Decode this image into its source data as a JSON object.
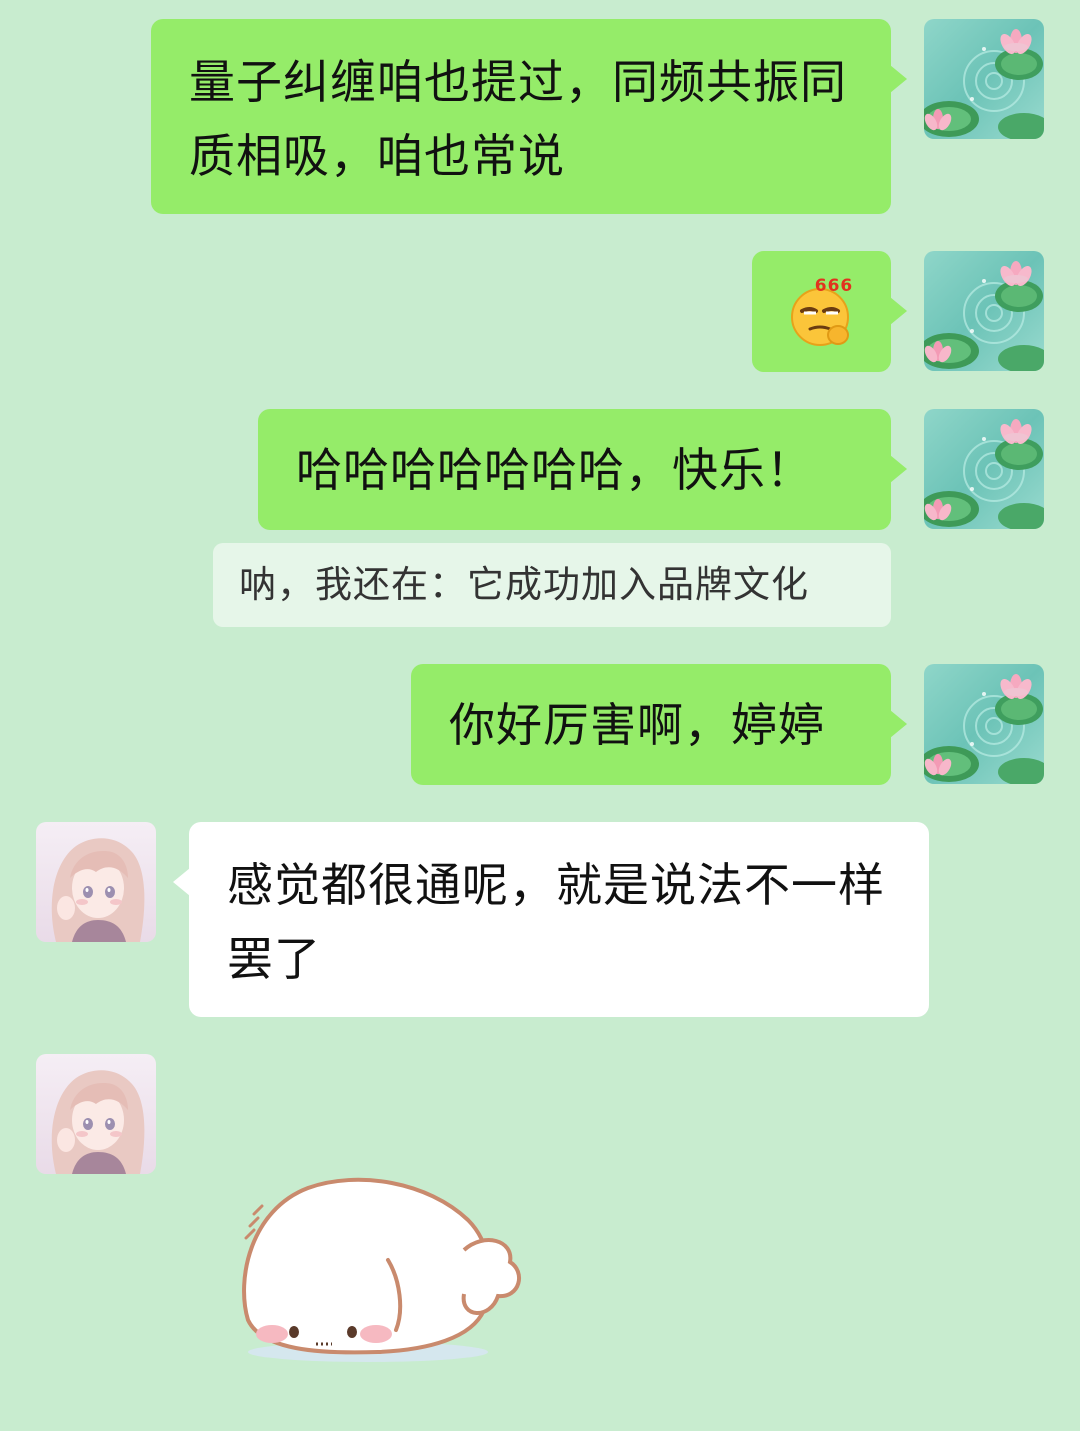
{
  "colors": {
    "background": "#c8eccf",
    "my_bubble": "#95ec69",
    "other_bubble": "#ffffff",
    "quote_background": "#e4f6e6"
  },
  "messages": [
    {
      "side": "me",
      "type": "text",
      "text": "量子纠缠咱也提过，同频共振同质相吸，咱也常说"
    },
    {
      "side": "me",
      "type": "emoji",
      "emoji_name": "smirk-666-emoji",
      "emoji_text": "666"
    },
    {
      "side": "me",
      "type": "text",
      "text": "哈哈哈哈哈哈哈，快乐！"
    },
    {
      "side": "me",
      "type": "quote",
      "text": "呐，我还在：它成功加入品牌文化"
    },
    {
      "side": "me",
      "type": "text",
      "text": "你好厉害啊，婷婷"
    },
    {
      "side": "other",
      "type": "text",
      "text": "感觉都很通呢，就是说法不一样罢了"
    },
    {
      "side": "other",
      "type": "sticker",
      "sticker_name": "bowing-bun-sticker"
    }
  ],
  "avatars": {
    "me": "lotus-pond-avatar",
    "other": "anime-girl-avatar"
  }
}
